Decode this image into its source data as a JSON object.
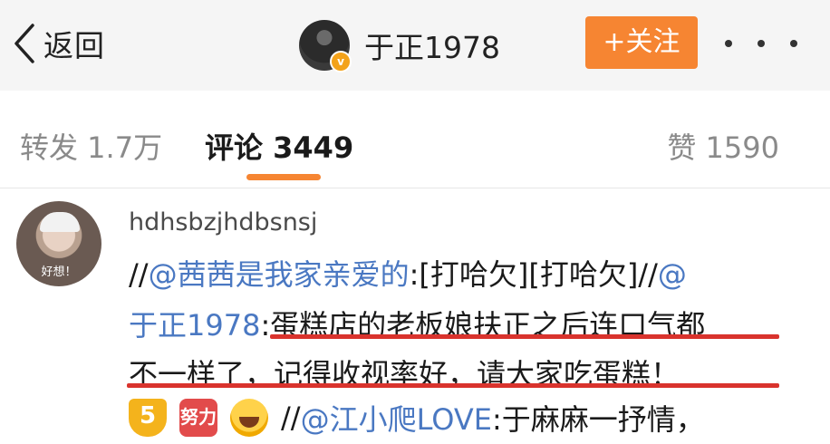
{
  "nav": {
    "back_label": "返回",
    "user_name": "于正1978",
    "follow_label": "+关注",
    "verified_badge": "v"
  },
  "tabs": {
    "repost": "转发 1.7万",
    "comment": "评论 3449",
    "like": "赞 1590"
  },
  "comment": {
    "avatar_caption": "好想！",
    "username": "hdhsbzjhdbsnsj",
    "line1": {
      "prefix": "//",
      "mention": "@茜茜是我家亲爱的",
      "text": ":[打哈欠][打哈欠]//",
      "mention2": "@"
    },
    "line2": {
      "mention": "于正1978",
      "text": ":蛋糕店的老板娘扶正之后连口气都"
    },
    "line3": {
      "text": "不一样了，记得收视率好，请大家吃蛋糕！"
    },
    "line4": {
      "emoji1": "5",
      "emoji2": "努力",
      "prefix": "//",
      "mention": "@江小爬LOVE",
      "text": ":于麻麻一抒情，"
    }
  },
  "colors": {
    "accent": "#f68532",
    "mention": "#4a78c2",
    "underline": "#d9332d"
  }
}
